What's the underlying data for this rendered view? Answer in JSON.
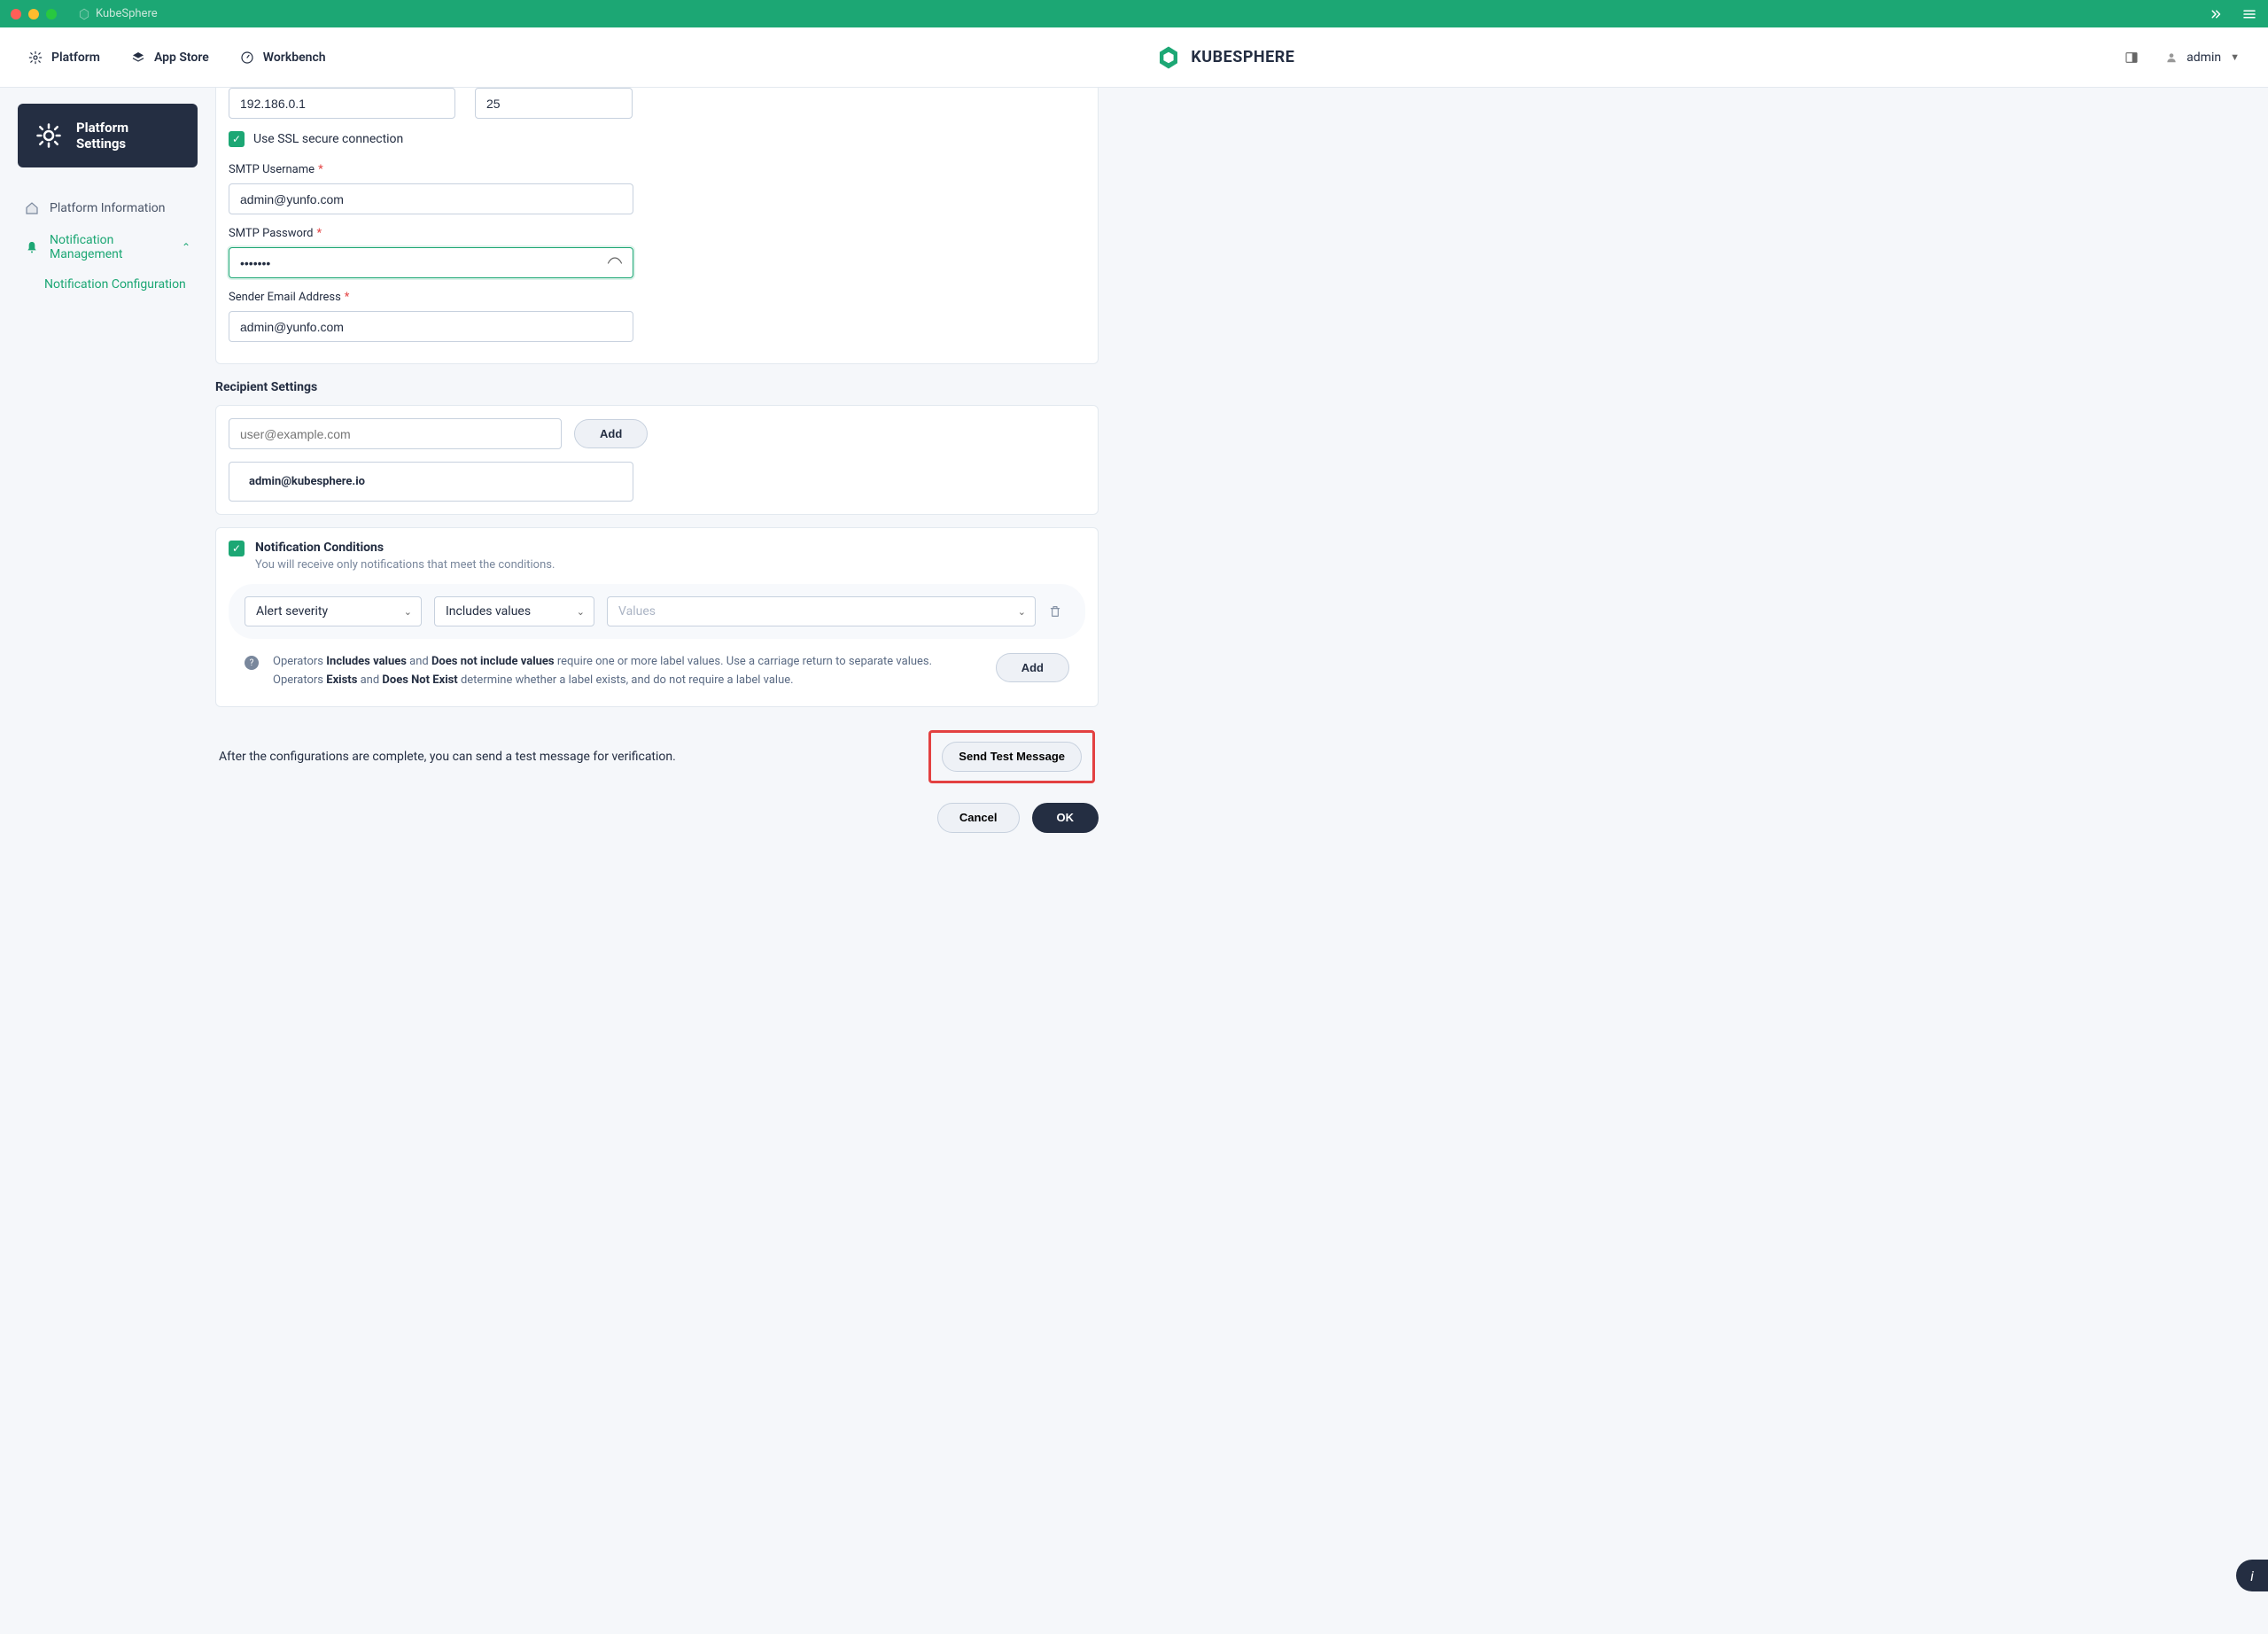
{
  "window": {
    "title": "KubeSphere"
  },
  "topnav": {
    "platform": "Platform",
    "app_store": "App Store",
    "workbench": "Workbench",
    "brand": "KUBESPHERE",
    "user": "admin"
  },
  "sidebar": {
    "settings_title": "Platform Settings",
    "items": {
      "platform_info": "Platform Information",
      "notif_mgmt": "Notification Management",
      "notif_config": "Notification Configuration"
    }
  },
  "form": {
    "server_ip": "192.186.0.1",
    "server_port": "25",
    "ssl_label": "Use SSL secure connection",
    "username_label": "SMTP Username",
    "username_value": "admin@yunfo.com",
    "password_label": "SMTP Password",
    "password_value": "•••••••",
    "sender_label": "Sender Email Address",
    "sender_value": "admin@yunfo.com"
  },
  "recipients": {
    "section_title": "Recipient Settings",
    "placeholder": "user@example.com",
    "add_btn": "Add",
    "items": [
      "admin@kubesphere.io"
    ]
  },
  "conditions": {
    "title": "Notification Conditions",
    "desc": "You will receive only notifications that meet the conditions.",
    "sel_label": "Alert severity",
    "sel_operator": "Includes values",
    "sel_values_placeholder": "Values",
    "info_prefix": "Operators ",
    "info_b1": "Includes values",
    "info_and": " and ",
    "info_b2": "Does not include values",
    "info_mid": " require one or more label values. Use a carriage return to separate values. Operators ",
    "info_b3": "Exists",
    "info_b4": "Does Not Exist",
    "info_suffix": " determine whether a label exists, and do not require a label value.",
    "add_btn": "Add"
  },
  "footer": {
    "test_text": "After the configurations are complete, you can send a test message for verification.",
    "send_test": "Send Test Message",
    "cancel": "Cancel",
    "ok": "OK"
  }
}
